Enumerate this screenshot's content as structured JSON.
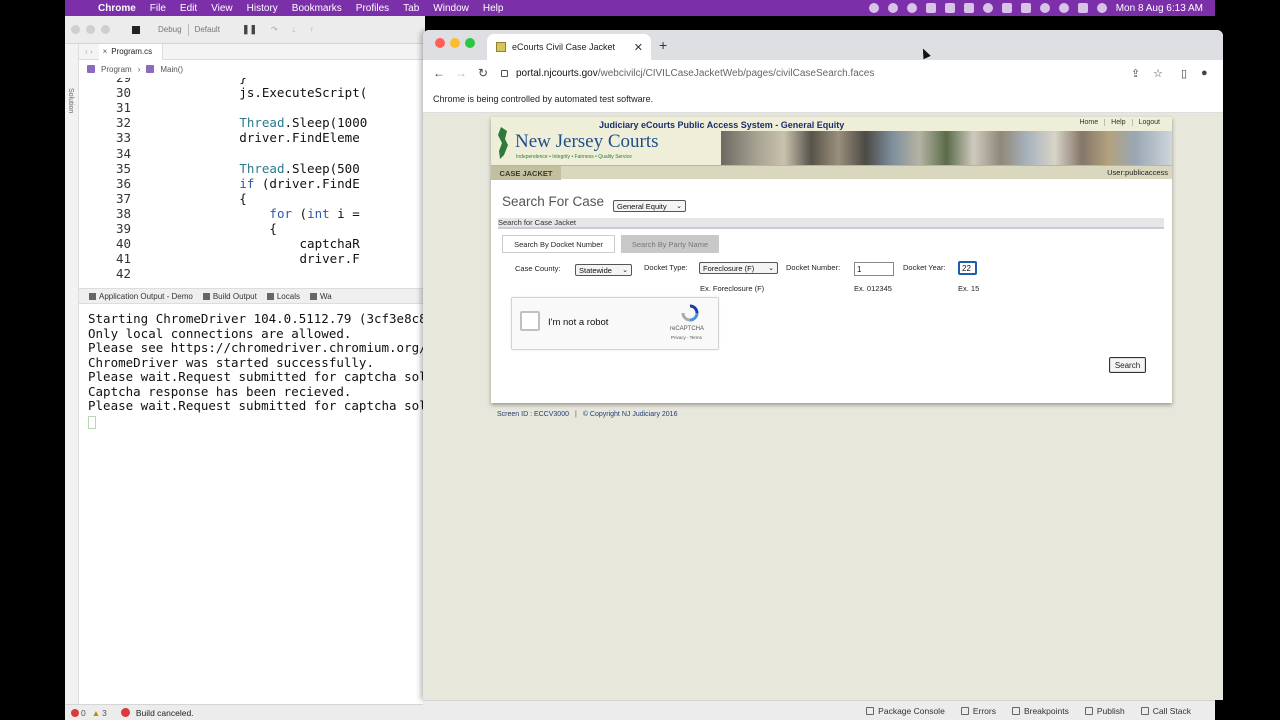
{
  "menubar": {
    "app": "Chrome",
    "items": [
      "File",
      "Edit",
      "View",
      "History",
      "Bookmarks",
      "Profiles",
      "Tab",
      "Window",
      "Help"
    ],
    "datetime": "Mon 8 Aug  6:13 AM"
  },
  "ide": {
    "toolbar": {
      "config": "Debug",
      "target": "Default"
    },
    "tab": "Program.cs",
    "breadcrumb": [
      "Program",
      "Main()"
    ],
    "solution_label": "Solution",
    "code_lines": [
      {
        "n": "29",
        "t": "            }"
      },
      {
        "n": "30",
        "t": "            js.ExecuteScript("
      },
      {
        "n": "31",
        "t": ""
      },
      {
        "n": "32",
        "t": "            Thread.Sleep(1000"
      },
      {
        "n": "33",
        "t": "            driver.FindEleme"
      },
      {
        "n": "34",
        "t": ""
      },
      {
        "n": "35",
        "t": "            Thread.Sleep(500"
      },
      {
        "n": "36",
        "t": "            if (driver.FindE"
      },
      {
        "n": "37",
        "t": "            {"
      },
      {
        "n": "38",
        "t": "                for (int i ="
      },
      {
        "n": "39",
        "t": "                {"
      },
      {
        "n": "40",
        "t": "                    captchaR"
      },
      {
        "n": "41",
        "t": "                    driver.F"
      },
      {
        "n": "42",
        "t": ""
      }
    ],
    "panel_tabs": [
      "Application Output - Demo",
      "Build Output",
      "Locals",
      "Wa"
    ],
    "output_lines": [
      "Starting ChromeDriver 104.0.5112.79 (3cf3e8c8",
      "Only local connections are allowed.",
      "Please see https://chromedriver.chromium.org/",
      "ChromeDriver was started successfully.",
      "Please wait.Request submitted for captcha sol",
      "Captcha response has been recieved.",
      "Please wait.Request submitted for captcha sol"
    ],
    "status": {
      "errors": "0",
      "warnings": "3",
      "message": "Build canceled."
    },
    "bottom_tools": [
      "Package Console",
      "Errors",
      "Breakpoints",
      "Publish",
      "Call Stack"
    ]
  },
  "browser": {
    "tab_title": "eCourts Civil Case Jacket",
    "url_host": "portal.njcourts.gov",
    "url_path": "/webcivilcj/CIVILCaseJacketWeb/pages/civilCaseSearch.faces",
    "infobar": "Chrome is being controlled by automated test software."
  },
  "page": {
    "system_title": "Judiciary eCourts Public Access System - General Equity",
    "logo_title": "New Jersey Courts",
    "logo_tagline": "Independence • Integrity • Fairness • Quality Service",
    "topnav": [
      "Home",
      "Help",
      "Logout"
    ],
    "case_jacket_tab": "CASE JACKET",
    "user": "User:publicaccess",
    "search_title": "Search For Case",
    "court_select": "General Equity",
    "section_title": "Search for Case Jacket",
    "tab_docket": "Search By Docket Number",
    "tab_party": "Search By Party Name",
    "county_label": "Case County:",
    "county_value": "Statewide",
    "doctype_label": "Docket Type:",
    "doctype_value": "Foreclosure (F)",
    "doctype_hint": "Ex. Foreclosure (F)",
    "docknum_label": "Docket Number:",
    "docknum_value": "1",
    "docknum_hint": "Ex. 012345",
    "dockyear_label": "Docket Year:",
    "dockyear_value": "22",
    "dockyear_hint": "Ex. 15",
    "recaptcha_text": "I'm not a robot",
    "recaptcha_brand": "reCAPTCHA",
    "recaptcha_terms": "Privacy - Terms",
    "search_button": "Search",
    "footer_screen": "Screen ID : ECCV3000",
    "footer_copyright": "© Copyright NJ Judiciary 2016"
  }
}
